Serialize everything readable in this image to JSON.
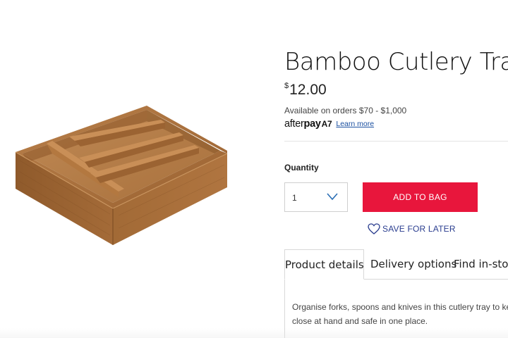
{
  "product": {
    "title": "Bamboo Cutlery Tray",
    "currency_symbol": "$",
    "price": "12.00",
    "image_icon": "bamboo-cutlery-tray-photo"
  },
  "afterpay": {
    "availability": "Available on orders $70 - $1,000",
    "logo_text_light": "after",
    "logo_text_bold": "pay",
    "logo_mark": "A7",
    "learn_more": "Learn more"
  },
  "purchase": {
    "quantity_label": "Quantity",
    "quantity_value": "1",
    "add_to_bag_label": "ADD TO BAG",
    "save_for_later_label": "SAVE FOR LATER",
    "accent_color": "#e8163c",
    "link_color": "#2a3d8f"
  },
  "tabs": [
    {
      "label": "Product details",
      "active": true
    },
    {
      "label": "Delivery options",
      "active": false
    },
    {
      "label": "Find in-store",
      "active": false
    }
  ],
  "description": {
    "line1": "Organise forks, spoons and knives in this cutlery tray to keep w",
    "line2": "close at hand and safe in one place."
  }
}
